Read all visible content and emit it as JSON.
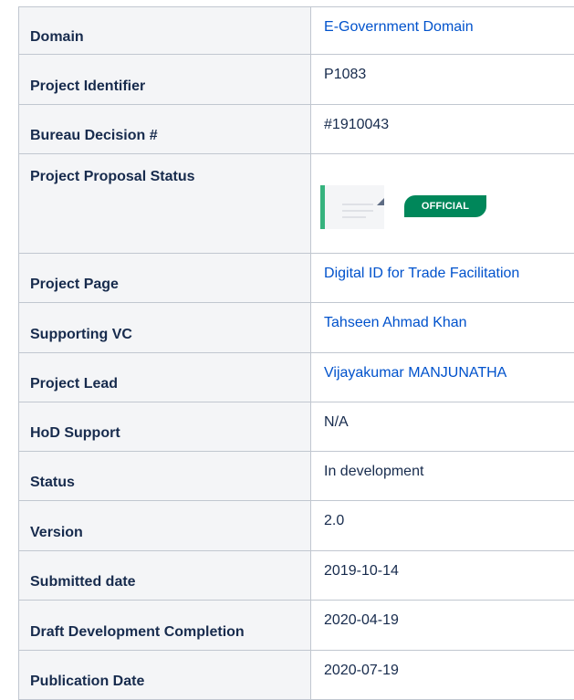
{
  "rows": [
    {
      "key": "Domain",
      "value": "E-Government Domain",
      "link": true
    },
    {
      "key": "Project Identifier",
      "value": "P1083",
      "link": false
    },
    {
      "key": "Bureau Decision #",
      "value": "#1910043",
      "link": false
    },
    {
      "key": "Project Proposal Status",
      "value": "",
      "link": false
    },
    {
      "key": "Project Page",
      "value": "Digital ID for Trade Facilitation",
      "link": true
    },
    {
      "key": "Supporting VC",
      "value": "Tahseen Ahmad Khan",
      "link": true
    },
    {
      "key": "Project Lead",
      "value": "Vijayakumar MANJUNATHA",
      "link": true
    },
    {
      "key": "HoD Support",
      "value": "N/A",
      "link": false
    },
    {
      "key": "Status",
      "value": "In development",
      "link": false
    },
    {
      "key": "Version",
      "value": "2.0",
      "link": false
    },
    {
      "key": "Submitted date",
      "value": "2019-10-14",
      "link": false
    },
    {
      "key": "Draft Development Completion",
      "value": "2020-04-19",
      "link": false
    },
    {
      "key": "Publication Date",
      "value": "2020-07-19",
      "link": false
    }
  ],
  "proposal_status": {
    "badge_label": "OFFICIAL",
    "badge_color": "#00875a",
    "thumbnail_icon": "document-thumbnail-icon"
  },
  "colors": {
    "link": "#0052cc",
    "text": "#172b4d",
    "header_bg": "#f4f5f7",
    "border": "#c1c7d0"
  }
}
